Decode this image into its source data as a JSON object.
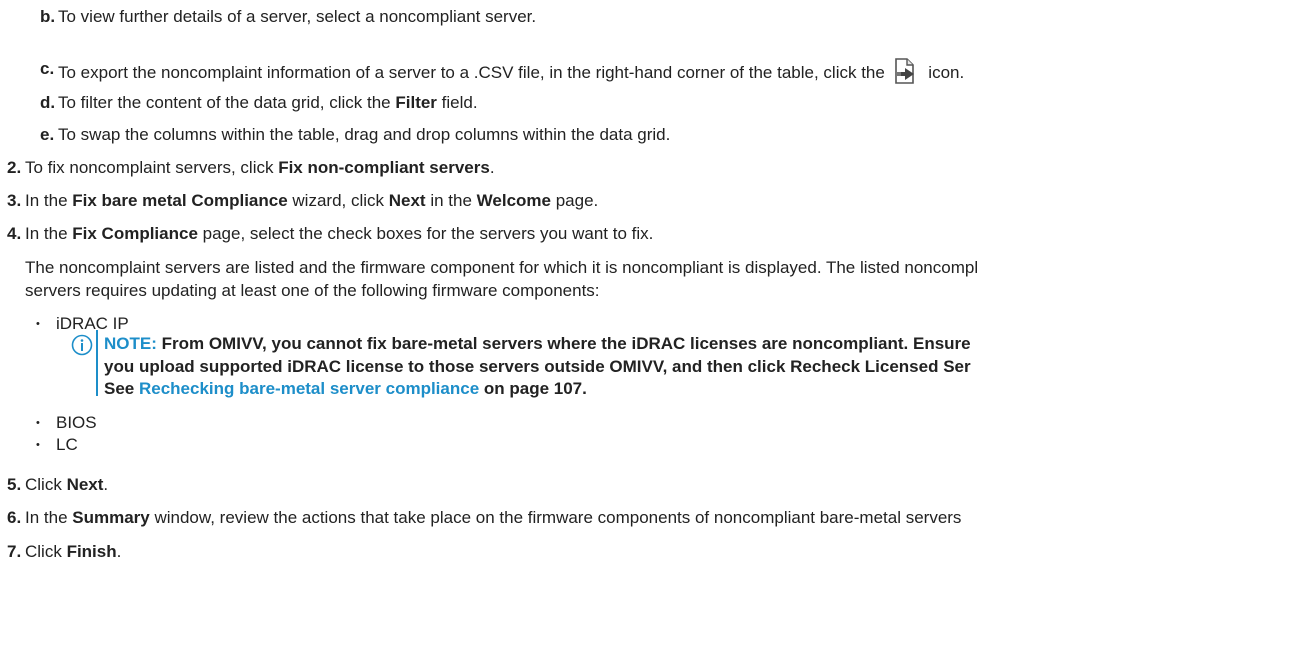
{
  "steps": {
    "b": {
      "marker": "b.",
      "text": "To view further details of a server, select a noncompliant server."
    },
    "c": {
      "marker": "c.",
      "pre": "To export the noncomplaint information of a server to a .CSV file, in the right-hand corner of the table, click the",
      "post": "icon.",
      "icon": "export-file-icon"
    },
    "d": {
      "marker": "d.",
      "pre": "To filter the content of the data grid, click the ",
      "bold": "Filter",
      "post": " field."
    },
    "e": {
      "marker": "e.",
      "text": "To swap the columns within the table, drag and drop columns within the data grid."
    },
    "s2": {
      "marker": "2.",
      "pre": "To fix noncomplaint servers, click ",
      "bold": "Fix non-compliant servers",
      "post": "."
    },
    "s3": {
      "marker": "3.",
      "pre": "In the ",
      "bold1": "Fix bare metal Compliance",
      "mid1": " wizard, click ",
      "bold2": "Next",
      "mid2": " in the ",
      "bold3": "Welcome",
      "post": " page."
    },
    "s4": {
      "marker": "4.",
      "pre": "In the ",
      "bold": "Fix Compliance",
      "post": " page, select the check boxes for the servers you want to fix."
    },
    "s4_para_line1": "The noncomplaint servers are listed and the firmware component for which it is noncompliant is displayed. The listed noncompl",
    "s4_para_line2": "servers requires updating at least one of the following firmware components:",
    "components": [
      "iDRAC IP",
      "BIOS",
      "LC"
    ],
    "bullet_char": "•",
    "note": {
      "icon": "info-circle-icon",
      "label": "NOTE:",
      "line1": " From OMIVV, you cannot fix bare-metal servers where the iDRAC licenses are noncompliant. Ensure",
      "line2": "you upload supported iDRAC license to those servers outside OMIVV, and then click Recheck Licensed Ser",
      "line3_pre": "See ",
      "line3_link": "Rechecking bare-metal server compliance",
      "line3_post": " on page 107."
    },
    "s5": {
      "marker": "5.",
      "pre": "Click ",
      "bold": "Next",
      "post": "."
    },
    "s6": {
      "marker": "6.",
      "pre": "In the ",
      "bold": "Summary",
      "post": " window, review the actions that take place on the firmware components of noncompliant bare-metal servers"
    },
    "s7": {
      "marker": "7.",
      "pre": "Click ",
      "bold": "Finish",
      "post": "."
    }
  },
  "colors": {
    "text": "#222222",
    "accent": "#1d8ec9"
  }
}
